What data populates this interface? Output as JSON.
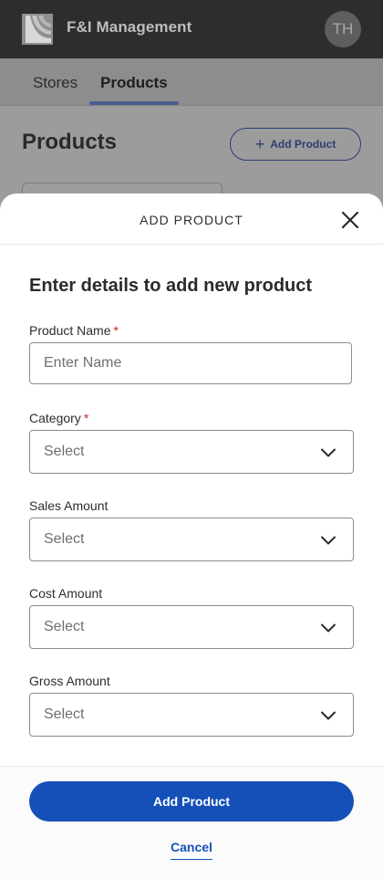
{
  "app": {
    "brand": "F&I Management",
    "avatar_initials": "TH",
    "tabs": [
      "Stores",
      "Products"
    ],
    "active_tab": "Products",
    "page_title": "Products",
    "add_button_label": "Add Product"
  },
  "modal": {
    "title": "ADD PRODUCT",
    "heading": "Enter details to add new product",
    "fields": {
      "product_name": {
        "label": "Product Name",
        "required_mark": "*",
        "placeholder": "Enter Name",
        "value": ""
      },
      "category": {
        "label": "Category",
        "required_mark": "*",
        "value": "Select"
      },
      "sales_amount": {
        "label": "Sales Amount",
        "value": "Select"
      },
      "cost_amount": {
        "label": "Cost Amount",
        "value": "Select"
      },
      "gross_amount": {
        "label": "Gross Amount",
        "value": "Select"
      }
    },
    "primary_button": "Add Product",
    "cancel_link": "Cancel"
  },
  "colors": {
    "primary": "#1550b8",
    "required": "#d32121",
    "appbar": "#2d2d2d"
  },
  "icons": {
    "logo": "fi-logo-icon",
    "close": "close-icon",
    "chevron": "chevron-down-icon",
    "plus": "plus-icon"
  }
}
